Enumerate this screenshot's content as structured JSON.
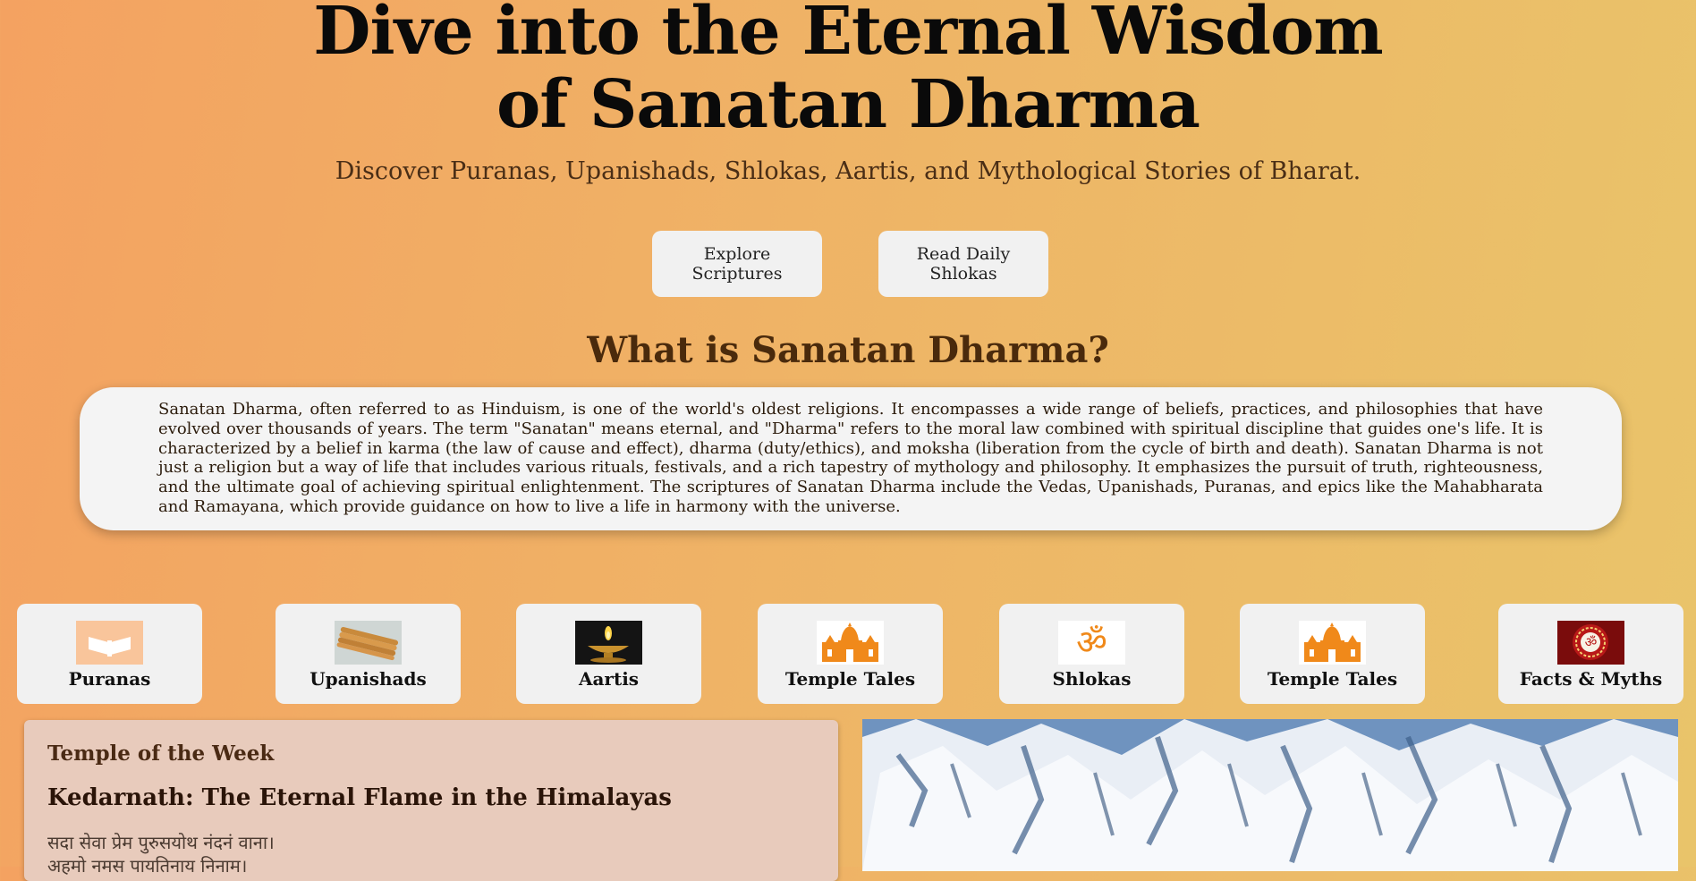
{
  "hero": {
    "title_line1": "Dive into the Eternal Wisdom",
    "title_line2": "of Sanatan Dharma",
    "subtitle": "Discover Puranas, Upanishads, Shlokas, Aartis, and Mythological Stories of Bharat.",
    "buttons": [
      "Explore Scriptures",
      "Read Daily Shlokas"
    ]
  },
  "about": {
    "heading": "What is Sanatan Dharma?",
    "body": "Sanatan Dharma, often referred to as Hinduism, is one of the world's oldest religions. It encompasses a wide range of beliefs, practices, and philosophies that have evolved over thousands of years. The term \"Sanatan\" means eternal, and \"Dharma\" refers to the moral law combined with spiritual discipline that guides one's life. It is characterized by a belief in karma (the law of cause and effect), dharma (duty/ethics), and moksha (liberation from the cycle of birth and death). Sanatan Dharma is not just a religion but a way of life that includes various rituals, festivals, and a rich tapestry of mythology and philosophy. It emphasizes the pursuit of truth, righteousness, and the ultimate goal of achieving spiritual enlightenment. The scriptures of Sanatan Dharma include the Vedas, Upanishads, Puranas, and epics like the Mahabharata and Ramayana, which provide guidance on how to live a life in harmony with the universe."
  },
  "categories": [
    {
      "label": "Puranas",
      "icon": "book-icon"
    },
    {
      "label": "Upanishads",
      "icon": "palm-leaf-manuscript-icon"
    },
    {
      "label": "Aartis",
      "icon": "diya-lamp-icon"
    },
    {
      "label": "Temple Tales",
      "icon": "temple-icon"
    },
    {
      "label": "Shlokas",
      "icon": "om-icon"
    },
    {
      "label": "Temple Tales",
      "icon": "temple-icon"
    },
    {
      "label": "Facts & Myths",
      "icon": "om-mandala-icon"
    }
  ],
  "temple_of_week": {
    "kicker": "Temple of the Week",
    "title": "Kedarnath: The Eternal Flame in the Himalayas",
    "verse_line1": "सदा सेवा प्रेम पुरुसयोथ नंदनं वाना।",
    "verse_line2": "अहमो नमस पायतिनाय निनाम।"
  },
  "colors": {
    "background_start": "#f4a261",
    "background_end": "#e9c46a",
    "card": "#f1f1f1",
    "icon_orange": "#f0891a",
    "temple_card": "#e8cbbc"
  }
}
